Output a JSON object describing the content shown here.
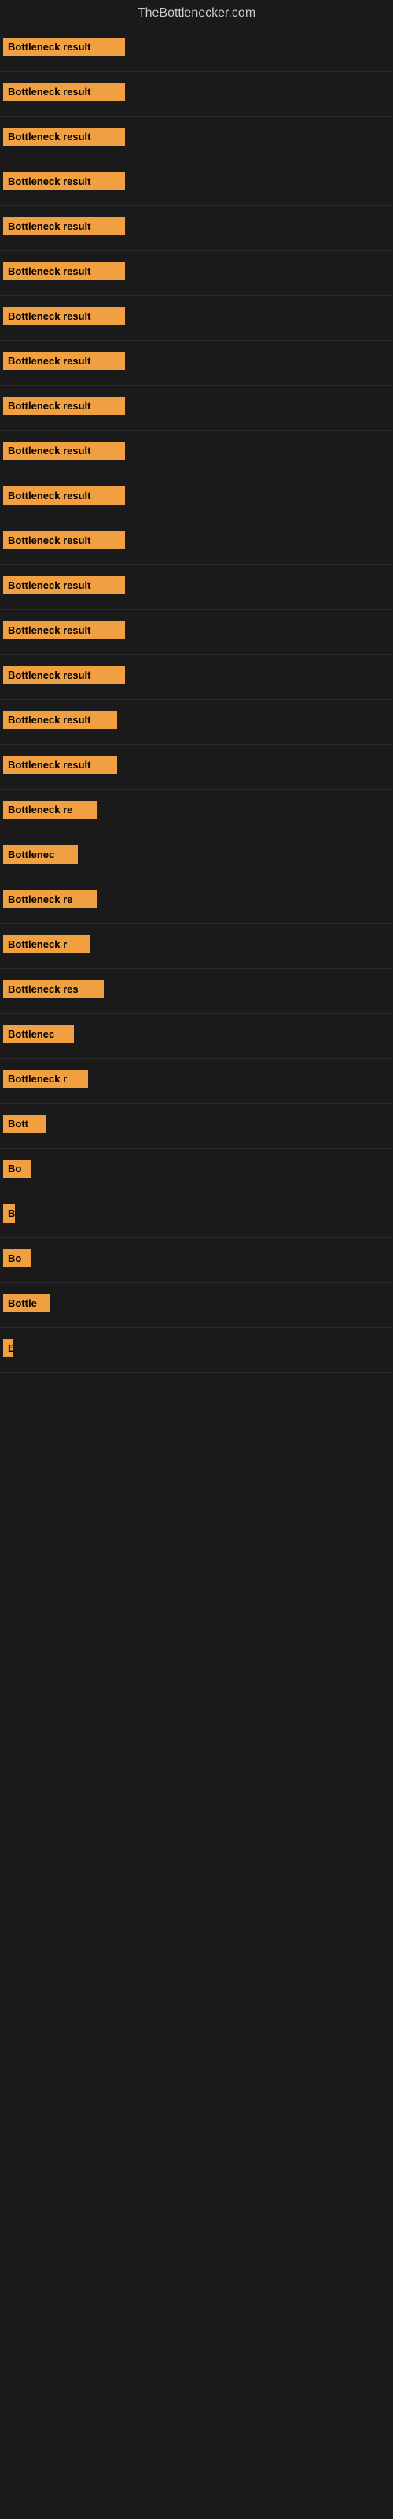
{
  "site": {
    "title": "TheBottlenecker.com"
  },
  "bars": [
    {
      "label": "Bottleneck result",
      "width": 155
    },
    {
      "label": "Bottleneck result",
      "width": 155
    },
    {
      "label": "Bottleneck result",
      "width": 155
    },
    {
      "label": "Bottleneck result",
      "width": 155
    },
    {
      "label": "Bottleneck result",
      "width": 155
    },
    {
      "label": "Bottleneck result",
      "width": 155
    },
    {
      "label": "Bottleneck result",
      "width": 155
    },
    {
      "label": "Bottleneck result",
      "width": 155
    },
    {
      "label": "Bottleneck result",
      "width": 155
    },
    {
      "label": "Bottleneck result",
      "width": 155
    },
    {
      "label": "Bottleneck result",
      "width": 155
    },
    {
      "label": "Bottleneck result",
      "width": 155
    },
    {
      "label": "Bottleneck result",
      "width": 155
    },
    {
      "label": "Bottleneck result",
      "width": 155
    },
    {
      "label": "Bottleneck result",
      "width": 155
    },
    {
      "label": "Bottleneck result",
      "width": 145
    },
    {
      "label": "Bottleneck result",
      "width": 145
    },
    {
      "label": "Bottleneck re",
      "width": 120
    },
    {
      "label": "Bottlenec",
      "width": 95
    },
    {
      "label": "Bottleneck re",
      "width": 120
    },
    {
      "label": "Bottleneck r",
      "width": 110
    },
    {
      "label": "Bottleneck res",
      "width": 128
    },
    {
      "label": "Bottlenec",
      "width": 90
    },
    {
      "label": "Bottleneck r",
      "width": 108
    },
    {
      "label": "Bott",
      "width": 55
    },
    {
      "label": "Bo",
      "width": 35
    },
    {
      "label": "B",
      "width": 15
    },
    {
      "label": "Bo",
      "width": 35
    },
    {
      "label": "Bottle",
      "width": 60
    },
    {
      "label": "B",
      "width": 12
    }
  ]
}
